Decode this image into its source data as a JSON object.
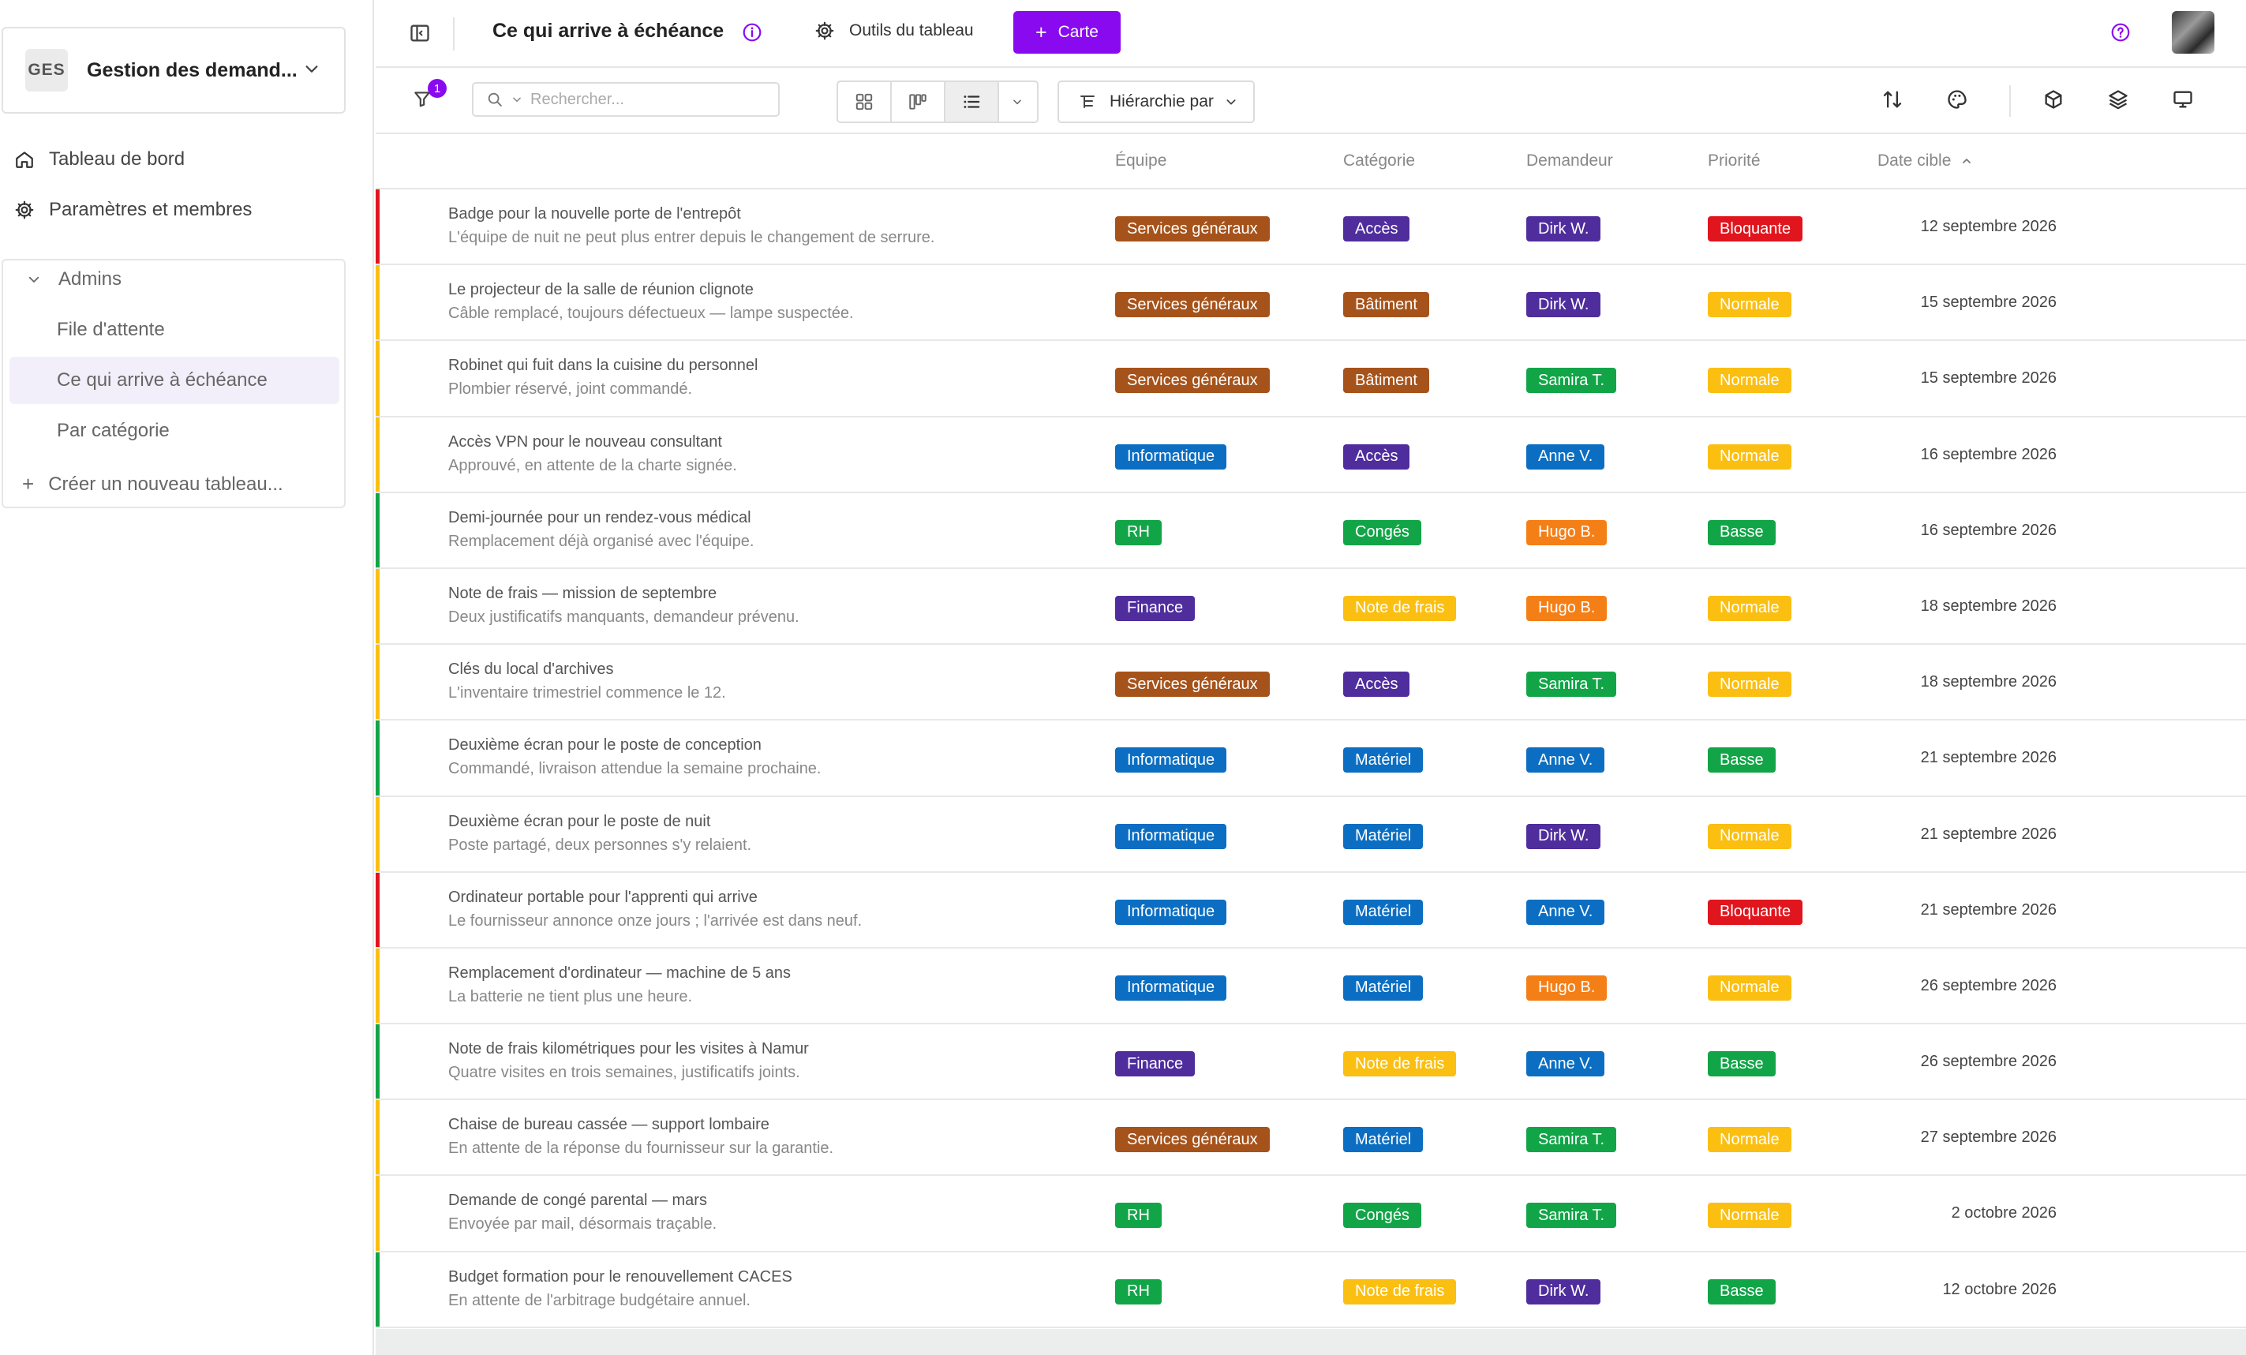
{
  "sidebar": {
    "workspace_initials": "GES",
    "workspace_name": "Gestion des demand...",
    "nav": [
      {
        "label": "Tableau de bord",
        "icon": "home-icon"
      },
      {
        "label": "Paramètres et membres",
        "icon": "gear-icon"
      }
    ],
    "group": {
      "label": "Admins",
      "items": [
        {
          "label": "File d'attente"
        },
        {
          "label": "Ce qui arrive à échéance",
          "active": true
        },
        {
          "label": "Par catégorie"
        }
      ]
    },
    "create_label": "Créer un nouveau tableau..."
  },
  "topbar": {
    "title": "Ce qui arrive à échéance",
    "tools_label": "Outils du tableau",
    "card_button_label": "Carte",
    "accent_color": "#8a0af0"
  },
  "toolbar": {
    "filter_count": "1",
    "search_placeholder": "Rechercher...",
    "hierarchy_label": "Hiérarchie par"
  },
  "table": {
    "headers": {
      "team": "Équipe",
      "category": "Catégorie",
      "requester": "Demandeur",
      "priority": "Priorité",
      "due": "Date cible"
    },
    "rows": [
      {
        "title": "Badge pour la nouvelle porte de l'entrepôt",
        "desc": "L'équipe de nuit ne peut plus entrer depuis le changement de serrure.",
        "team": "Services généraux",
        "category": "Accès",
        "requester": "Dirk W.",
        "priority": "Bloquante",
        "date": "12 septembre 2026"
      },
      {
        "title": "Le projecteur de la salle de réunion clignote",
        "desc": "Câble remplacé, toujours défectueux — lampe suspectée.",
        "team": "Services généraux",
        "category": "Bâtiment",
        "requester": "Dirk W.",
        "priority": "Normale",
        "date": "15 septembre 2026"
      },
      {
        "title": "Robinet qui fuit dans la cuisine du personnel",
        "desc": "Plombier réservé, joint commandé.",
        "team": "Services généraux",
        "category": "Bâtiment",
        "requester": "Samira T.",
        "priority": "Normale",
        "date": "15 septembre 2026"
      },
      {
        "title": "Accès VPN pour le nouveau consultant",
        "desc": "Approuvé, en attente de la charte signée.",
        "team": "Informatique",
        "category": "Accès",
        "requester": "Anne V.",
        "priority": "Normale",
        "date": "16 septembre 2026"
      },
      {
        "title": "Demi-journée pour un rendez-vous médical",
        "desc": "Remplacement déjà organisé avec l'équipe.",
        "team": "RH",
        "category": "Congés",
        "requester": "Hugo B.",
        "priority": "Basse",
        "date": "16 septembre 2026"
      },
      {
        "title": "Note de frais — mission de septembre",
        "desc": "Deux justificatifs manquants, demandeur prévenu.",
        "team": "Finance",
        "category": "Note de frais",
        "requester": "Hugo B.",
        "priority": "Normale",
        "date": "18 septembre 2026"
      },
      {
        "title": "Clés du local d'archives",
        "desc": "L'inventaire trimestriel commence le 12.",
        "team": "Services généraux",
        "category": "Accès",
        "requester": "Samira T.",
        "priority": "Normale",
        "date": "18 septembre 2026"
      },
      {
        "title": "Deuxième écran pour le poste de conception",
        "desc": "Commandé, livraison attendue la semaine prochaine.",
        "team": "Informatique",
        "category": "Matériel",
        "requester": "Anne V.",
        "priority": "Basse",
        "date": "21 septembre 2026"
      },
      {
        "title": "Deuxième écran pour le poste de nuit",
        "desc": "Poste partagé, deux personnes s'y relaient.",
        "team": "Informatique",
        "category": "Matériel",
        "requester": "Dirk W.",
        "priority": "Normale",
        "date": "21 septembre 2026"
      },
      {
        "title": "Ordinateur portable pour l'apprenti qui arrive",
        "desc": "Le fournisseur annonce onze jours ; l'arrivée est dans neuf.",
        "team": "Informatique",
        "category": "Matériel",
        "requester": "Anne V.",
        "priority": "Bloquante",
        "date": "21 septembre 2026"
      },
      {
        "title": "Remplacement d'ordinateur — machine de 5 ans",
        "desc": "La batterie ne tient plus une heure.",
        "team": "Informatique",
        "category": "Matériel",
        "requester": "Hugo B.",
        "priority": "Normale",
        "date": "26 septembre 2026"
      },
      {
        "title": "Note de frais kilométriques pour les visites à Namur",
        "desc": "Quatre visites en trois semaines, justificatifs joints.",
        "team": "Finance",
        "category": "Note de frais",
        "requester": "Anne V.",
        "priority": "Basse",
        "date": "26 septembre 2026"
      },
      {
        "title": "Chaise de bureau cassée — support lombaire",
        "desc": "En attente de la réponse du fournisseur sur la garantie.",
        "team": "Services généraux",
        "category": "Matériel",
        "requester": "Samira T.",
        "priority": "Normale",
        "date": "27 septembre 2026"
      },
      {
        "title": "Demande de congé parental — mars",
        "desc": "Envoyée par mail, désormais traçable.",
        "team": "RH",
        "category": "Congés",
        "requester": "Samira T.",
        "priority": "Normale",
        "date": "2 octobre 2026"
      },
      {
        "title": "Budget formation pour le renouvellement CACES",
        "desc": "En attente de l'arbitrage budgétaire annuel.",
        "team": "RH",
        "category": "Note de frais",
        "requester": "Dirk W.",
        "priority": "Basse",
        "date": "12 octobre 2026"
      }
    ]
  },
  "colors": {
    "team": {
      "Services généraux": "#a6531b",
      "Informatique": "#0b6ec2",
      "RH": "#12a548",
      "Finance": "#4f2d9c"
    },
    "category": {
      "Accès": "#4f2d9c",
      "Bâtiment": "#a6531b",
      "Congés": "#12a548",
      "Note de frais": "#fbbf12",
      "Matériel": "#0b6ec2"
    },
    "requester": {
      "Dirk W.": "#4f2d9c",
      "Samira T.": "#12a548",
      "Anne V.": "#0b6ec2",
      "Hugo B.": "#f47f17"
    },
    "priority": {
      "Bloquante": "#e0151d",
      "Normale": "#fbbf12",
      "Basse": "#12a548"
    }
  }
}
